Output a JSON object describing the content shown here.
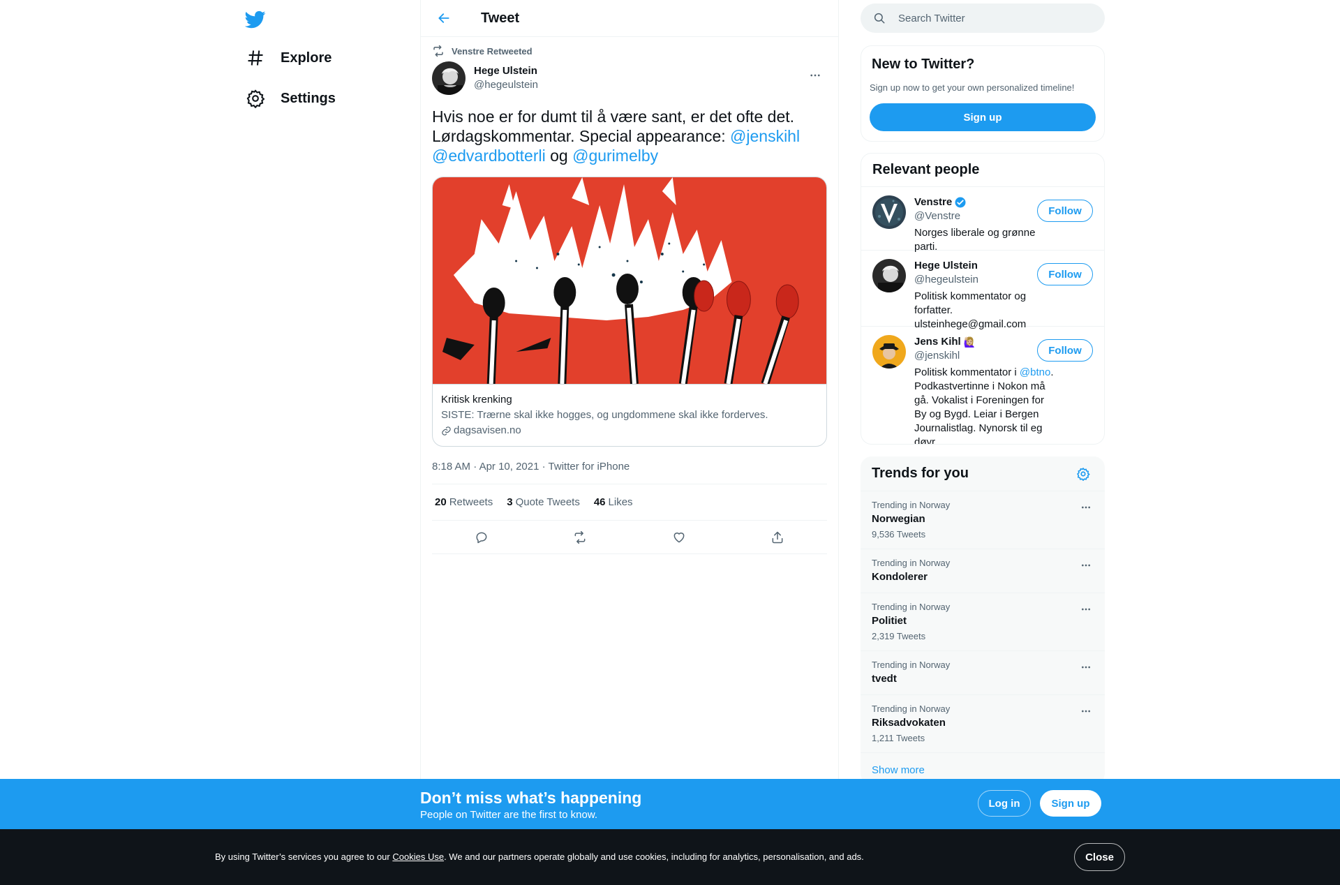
{
  "nav": {
    "explore_label": "Explore",
    "settings_label": "Settings"
  },
  "header": {
    "title": "Tweet"
  },
  "tweet": {
    "retweet_context": "Venstre Retweeted",
    "author_name": "Hege Ulstein",
    "author_handle": "@hegeulstein",
    "text_line1": "Hvis noe er for dumt til å være sant, er det ofte det.",
    "text_line2": "Lørdagskommentar. Special appearance:",
    "mention1": "@jenskihl",
    "mention2": "@edvardbotterli",
    "text_og": "og",
    "mention3": "@gurimelby",
    "card": {
      "title": "Kritisk krenking",
      "description": "SISTE: Trærne skal ikke hogges, og ungdommene skal ikke forderves.",
      "domain": "dagsavisen.no"
    },
    "time": "8:18 AM",
    "date": "Apr 10, 2021",
    "source": "Twitter for iPhone",
    "stats": {
      "retweets_count": "20",
      "retweets_label": "Retweets",
      "quotes_count": "3",
      "quotes_label": "Quote Tweets",
      "likes_count": "46",
      "likes_label": "Likes"
    }
  },
  "search": {
    "placeholder": "Search Twitter"
  },
  "new_to_twitter": {
    "title": "New to Twitter?",
    "subtitle": "Sign up now to get your own personalized timeline!",
    "button": "Sign up"
  },
  "relevant_people": {
    "title": "Relevant people",
    "follow_label": "Follow",
    "people": [
      {
        "name": "Venstre",
        "handle": "@Venstre",
        "bio": "Norges liberale og grønne parti."
      },
      {
        "name": "Hege Ulstein",
        "handle": "@hegeulstein",
        "bio": "Politisk kommentator og forfatter. ulsteinhege@gmail.com"
      },
      {
        "name": "Jens Kihl",
        "handle": "@jenskihl",
        "emoji": "🙋🏼‍♀️",
        "bio_pre": "Politisk kommentator i",
        "bio_link": "@btno",
        "bio_post": ". Podkastvertinne i Nokon må gå. Vokalist i Foreningen for By og Bygd. Leiar i Bergen Journalistlag. Nynorsk til eg døyr."
      }
    ]
  },
  "trends": {
    "title": "Trends for you",
    "items": [
      {
        "context": "Trending in Norway",
        "name": "Norwegian",
        "count": "9,536 Tweets"
      },
      {
        "context": "Trending in Norway",
        "name": "Kondolerer",
        "count": ""
      },
      {
        "context": "Trending in Norway",
        "name": "Politiet",
        "count": "2,319 Tweets"
      },
      {
        "context": "Trending in Norway",
        "name": "tvedt",
        "count": ""
      },
      {
        "context": "Trending in Norway",
        "name": "Riksadvokaten",
        "count": "1,211 Tweets"
      }
    ],
    "show_more": "Show more"
  },
  "bottom_bar": {
    "title": "Don’t miss what’s happening",
    "subtitle": "People on Twitter are the first to know.",
    "login": "Log in",
    "signup": "Sign up"
  },
  "cookie": {
    "text_pre": "By using Twitter’s services you agree to our",
    "link": "Cookies Use",
    "text_post": ". We and our partners operate globally and use cookies, including for analytics, personalisation, and ads.",
    "close": "Close"
  },
  "colors": {
    "brand_blue": "#1d9bf0",
    "text_primary": "#0f1419",
    "text_secondary": "#536471",
    "cookie_bg": "#0f1419",
    "card_image_red": "#e2402c"
  }
}
